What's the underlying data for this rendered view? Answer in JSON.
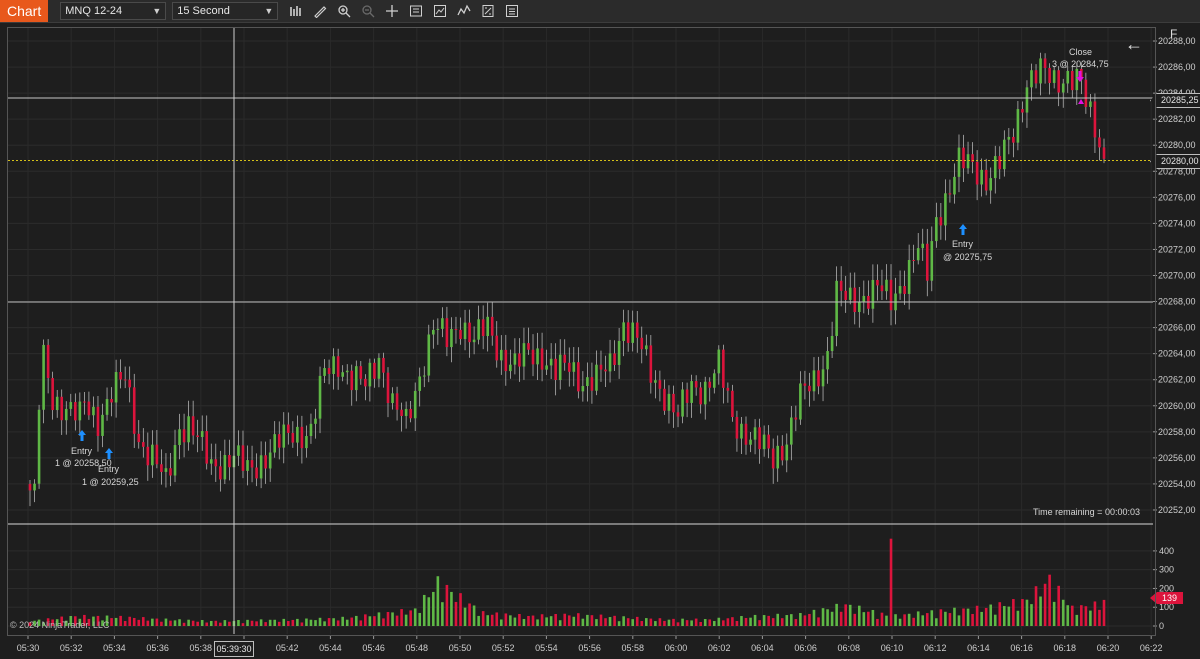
{
  "toolbar": {
    "chart_tab": "Chart",
    "instrument": "MNQ 12-24",
    "interval": "15 Second",
    "icons": [
      "bar-type-icon",
      "drawing-tool-icon",
      "zoom-in-icon",
      "zoom-out-icon",
      "crosshair-icon",
      "properties-icon",
      "strategies-icon",
      "indicators-icon",
      "chart-trader-icon",
      "data-box-icon"
    ]
  },
  "f_button": "F",
  "price_axis": [
    "20288,00",
    "20286,00",
    "20284,00",
    "20282,00",
    "20280,00",
    "20278,00",
    "20276,00",
    "20274,00",
    "20272,00",
    "20270,00",
    "20268,00",
    "20266,00",
    "20264,00",
    "20262,00",
    "20260,00",
    "20258,00",
    "20256,00",
    "20254,00",
    "20252,00"
  ],
  "volume_axis": [
    "400",
    "300",
    "200",
    "100",
    "0"
  ],
  "time_axis": [
    "05:30",
    "05:32",
    "05:34",
    "05:36",
    "05:38",
    "05:39:30",
    "05:42",
    "05:44",
    "05:46",
    "05:48",
    "05:50",
    "05:52",
    "05:54",
    "05:56",
    "05:58",
    "06:00",
    "06:02",
    "06:04",
    "06:06",
    "06:08",
    "06:10",
    "06:12",
    "06:14",
    "06:16",
    "06:18",
    "06:20",
    "06:22"
  ],
  "crosshair_time": "05:39:30",
  "price_tags": {
    "upper_line": "20285,25",
    "last_price": "20280,00"
  },
  "volume_tag": "139",
  "time_remaining": "Time remaining = 00:00:03",
  "copyright": "© 2024 NinjaTrader, LLC",
  "executions": [
    {
      "label": "Entry",
      "detail": "1 @ 20258,50"
    },
    {
      "label": "Entry",
      "detail": "1 @ 20259,25"
    },
    {
      "label": "Entry",
      "detail": "@ 20275,75"
    },
    {
      "label": "Close",
      "detail": "3 @ 20284,75"
    }
  ],
  "colors": {
    "up": "#5fb846",
    "down": "#dc143c",
    "last_line": "#d4c019",
    "entry_arrow": "#1e90ff",
    "close_arrow": "#e010e0"
  },
  "chart_data": {
    "type": "candlestick",
    "ylim": [
      20251,
      20289
    ],
    "anchors": [
      [
        0,
        20253.5
      ],
      [
        1,
        20253
      ],
      [
        2,
        20260
      ],
      [
        3,
        20263.5
      ],
      [
        5,
        20260.5
      ],
      [
        8,
        20260
      ],
      [
        11,
        20259
      ],
      [
        12,
        20260
      ],
      [
        15,
        20259
      ],
      [
        18,
        20261
      ],
      [
        21,
        20262
      ],
      [
        24,
        20257.5
      ],
      [
        27,
        20256
      ],
      [
        30,
        20254
      ],
      [
        33,
        20258.5
      ],
      [
        35,
        20258.5
      ],
      [
        40,
        20255.5
      ],
      [
        45,
        20256
      ],
      [
        48,
        20255
      ],
      [
        53,
        20256.5
      ],
      [
        58,
        20258
      ],
      [
        62,
        20258
      ],
      [
        65,
        20262.5
      ],
      [
        68,
        20263.5
      ],
      [
        71,
        20262
      ],
      [
        74,
        20261.5
      ],
      [
        77,
        20264
      ],
      [
        80,
        20260
      ],
      [
        83,
        20258.5
      ],
      [
        86,
        20262.5
      ],
      [
        89,
        20266
      ],
      [
        92,
        20265
      ],
      [
        95,
        20266.5
      ],
      [
        98,
        20265
      ],
      [
        101,
        20266
      ],
      [
        104,
        20264
      ],
      [
        107,
        20263
      ],
      [
        110,
        20264
      ],
      [
        113,
        20264
      ],
      [
        116,
        20262.5
      ],
      [
        119,
        20263
      ],
      [
        122,
        20262
      ],
      [
        125,
        20262
      ],
      [
        128,
        20263
      ],
      [
        131,
        20266.5
      ],
      [
        134,
        20265
      ],
      [
        137,
        20262.5
      ],
      [
        140,
        20261
      ],
      [
        143,
        20259
      ],
      [
        146,
        20261.5
      ],
      [
        149,
        20261.5
      ],
      [
        152,
        20263
      ],
      [
        155,
        20259
      ],
      [
        158,
        20258
      ],
      [
        161,
        20257
      ],
      [
        164,
        20256
      ],
      [
        167,
        20257.5
      ],
      [
        170,
        20260.5
      ],
      [
        173,
        20262
      ],
      [
        176,
        20264
      ],
      [
        178,
        20268.5
      ],
      [
        181,
        20268
      ],
      [
        184,
        20268.5
      ],
      [
        187,
        20269
      ],
      [
        190,
        20268
      ],
      [
        193,
        20270
      ],
      [
        196,
        20272
      ],
      [
        198,
        20270
      ],
      [
        200,
        20274.5
      ],
      [
        202,
        20276
      ],
      [
        205,
        20278.5
      ],
      [
        208,
        20278.5
      ],
      [
        211,
        20277.5
      ],
      [
        214,
        20278.5
      ],
      [
        217,
        20281
      ],
      [
        220,
        20285
      ],
      [
        223,
        20285.5
      ],
      [
        226,
        20285
      ],
      [
        229,
        20285.5
      ],
      [
        232,
        20284.5
      ],
      [
        233,
        20283
      ],
      [
        235,
        20281.5
      ],
      [
        237,
        20279
      ]
    ],
    "volume_anchors": [
      [
        0,
        30
      ],
      [
        10,
        60
      ],
      [
        20,
        55
      ],
      [
        30,
        40
      ],
      [
        40,
        30
      ],
      [
        50,
        35
      ],
      [
        60,
        40
      ],
      [
        70,
        50
      ],
      [
        85,
        100
      ],
      [
        90,
        270
      ],
      [
        100,
        80
      ],
      [
        110,
        60
      ],
      [
        120,
        70
      ],
      [
        130,
        55
      ],
      [
        140,
        40
      ],
      [
        150,
        40
      ],
      [
        160,
        60
      ],
      [
        170,
        70
      ],
      [
        180,
        130
      ],
      [
        190,
        60
      ],
      [
        200,
        90
      ],
      [
        210,
        110
      ],
      [
        220,
        160
      ],
      [
        225,
        290
      ],
      [
        230,
        110
      ],
      [
        237,
        139
      ]
    ],
    "volume_spike": {
      "bar": 190,
      "value": 465
    },
    "bar_count": 238,
    "volume_ylim": [
      0,
      490
    ]
  }
}
